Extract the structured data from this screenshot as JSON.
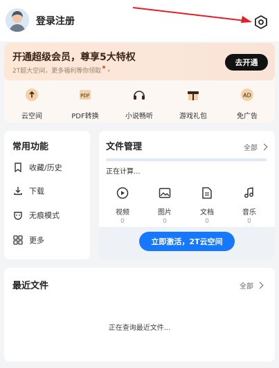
{
  "header": {
    "login_label": "登录注册"
  },
  "vip": {
    "title": "开通超级会员，尊享5大特权",
    "subtitle": "2T超大空间，更多福利等你领取",
    "button": "去开通"
  },
  "benefits": [
    {
      "label": "云空间",
      "icon": "cloud-upload-icon"
    },
    {
      "label": "PDF转换",
      "icon": "pdf-convert-icon"
    },
    {
      "label": "小说畅听",
      "icon": "headphones-icon"
    },
    {
      "label": "游戏礼包",
      "icon": "gift-icon"
    },
    {
      "label": "免广告",
      "icon": "ad-free-icon"
    }
  ],
  "common": {
    "title": "常用功能",
    "items": [
      {
        "label": "收藏/历史",
        "icon": "bookmark-icon"
      },
      {
        "label": "下载",
        "icon": "download-icon"
      },
      {
        "label": "无痕模式",
        "icon": "incognito-icon"
      },
      {
        "label": "更多",
        "icon": "grid-icon"
      }
    ]
  },
  "files": {
    "title": "文件管理",
    "all": "全部",
    "status": "正在计算...",
    "progress": 0.0,
    "categories": [
      {
        "name": "视频",
        "count": "0",
        "icon": "video-icon"
      },
      {
        "name": "图片",
        "count": "0",
        "icon": "image-icon"
      },
      {
        "name": "文档",
        "count": "0",
        "icon": "document-icon"
      },
      {
        "name": "音乐",
        "count": "0",
        "icon": "music-icon"
      }
    ],
    "activate": "立即激活，2T云空间"
  },
  "recent": {
    "title": "最近文件",
    "all": "全部",
    "status": "正在查询最近文件..."
  },
  "colors": {
    "accent": "#1677ff",
    "vip_button": "#121212",
    "annotation_arrow": "#e51d24"
  }
}
